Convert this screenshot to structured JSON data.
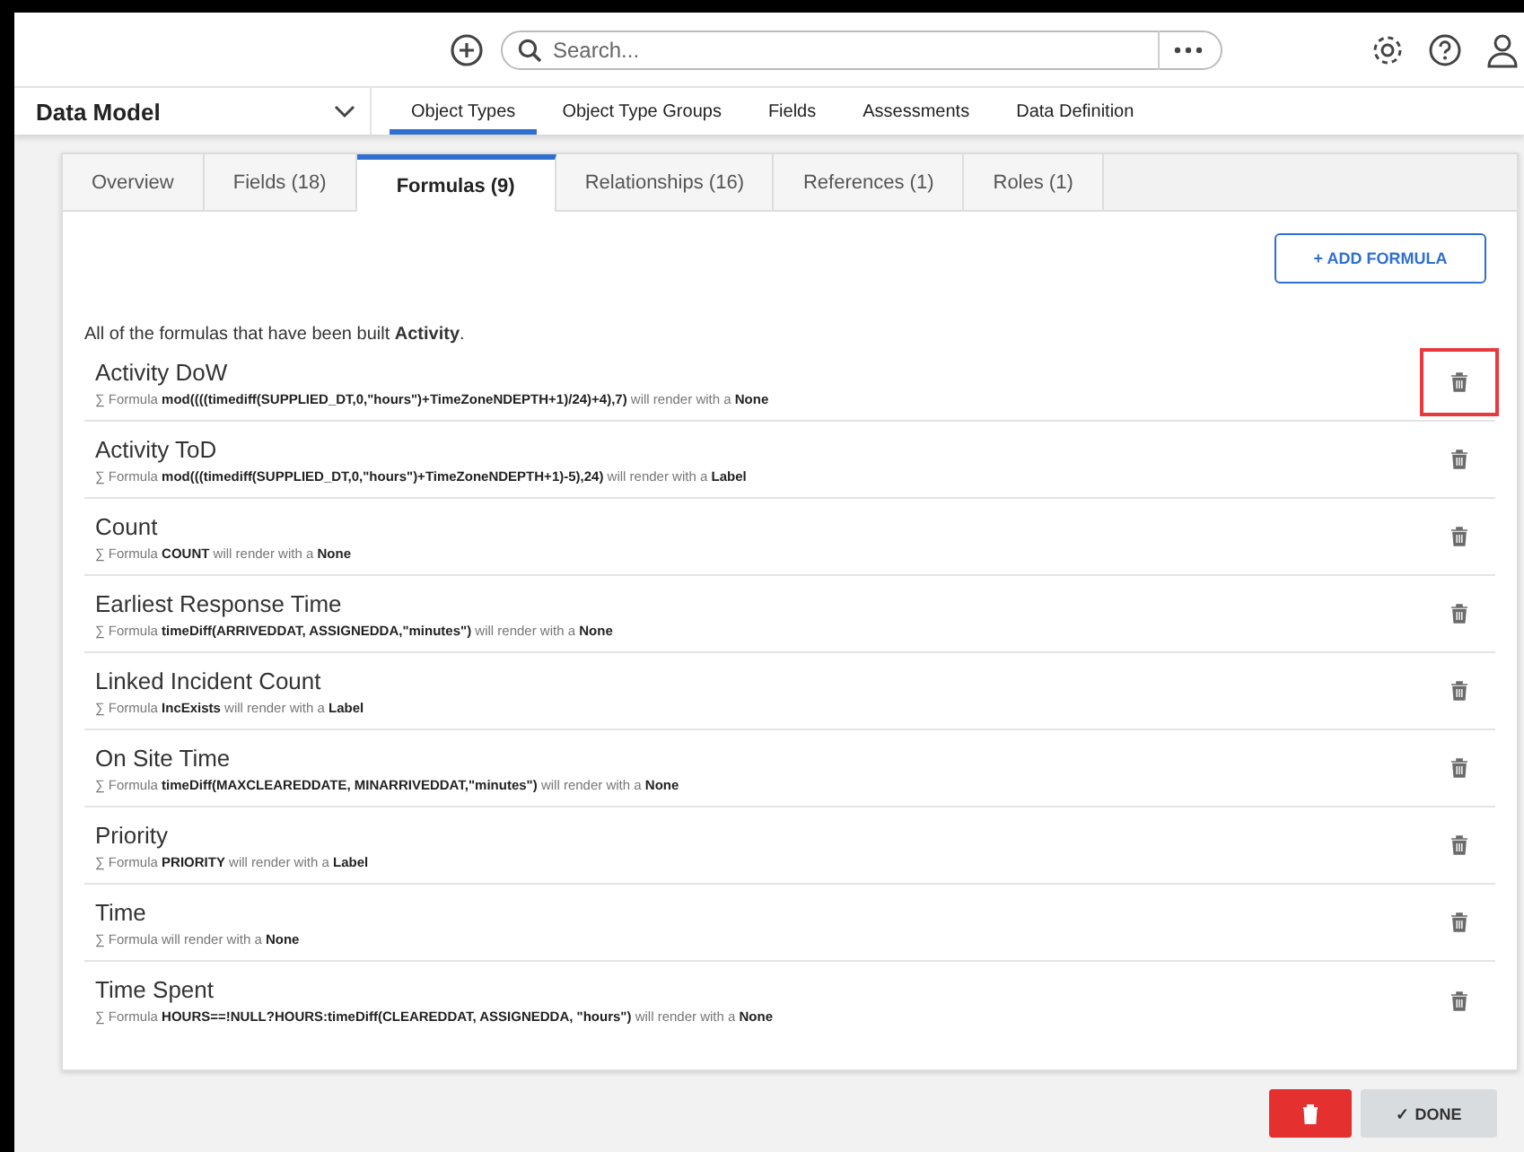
{
  "header": {
    "search": {
      "placeholder": "Search..."
    }
  },
  "nav": {
    "title": "Data Model",
    "items": [
      {
        "label": "Object Types",
        "selected": true
      },
      {
        "label": "Object Type Groups",
        "selected": false
      },
      {
        "label": "Fields",
        "selected": false
      },
      {
        "label": "Assessments",
        "selected": false
      },
      {
        "label": "Data Definition",
        "selected": false
      }
    ]
  },
  "tabs": [
    {
      "label": "Overview",
      "selected": false
    },
    {
      "label": "Fields (18)",
      "selected": false
    },
    {
      "label": "Formulas (9)",
      "selected": true
    },
    {
      "label": "Relationships (16)",
      "selected": false
    },
    {
      "label": "References (1)",
      "selected": false
    },
    {
      "label": "Roles (1)",
      "selected": false
    }
  ],
  "add_button": "+ ADD FORMULA",
  "intro": "All of the formulas that have been built **Activity**.",
  "formulas": [
    {
      "name": "Activity DoW",
      "description": "∑ Formula **mod((((timediff(SUPPLIED_DT,0,\"hours\")+TimeZoneNDEPTH+1)/24)+4),7)** will render with a **None**",
      "highlighted": true
    },
    {
      "name": "Activity ToD",
      "description": "∑ Formula **mod(((timediff(SUPPLIED_DT,0,\"hours\")+TimeZoneNDEPTH+1)-5),24)** will render with a **Label**",
      "highlighted": false
    },
    {
      "name": "Count",
      "description": "∑ Formula **COUNT** will render with a **None**",
      "highlighted": false
    },
    {
      "name": "Earliest Response Time",
      "description": "∑ Formula **timeDiff(ARRIVEDDAT, ASSIGNEDDA,\"minutes\")** will render with a **None**",
      "highlighted": false
    },
    {
      "name": "Linked Incident Count",
      "description": "∑ Formula **IncExists** will render with a **Label**",
      "highlighted": false
    },
    {
      "name": "On Site Time",
      "description": "∑ Formula **timeDiff(MAXCLEAREDDATE, MINARRIVEDDAT,\"minutes\")** will render with a **None**",
      "highlighted": false
    },
    {
      "name": "Priority",
      "description": "∑ Formula **PRIORITY** will render with a **Label**",
      "highlighted": false
    },
    {
      "name": "Time",
      "description": "∑ Formula will render with a **None**",
      "highlighted": false
    },
    {
      "name": "Time Spent",
      "description": "∑ Formula **HOURS==!NULL?HOURS:timeDiff(CLEAREDDAT, ASSIGNEDDA, \"hours\")** will render with a **None**",
      "highlighted": false
    }
  ],
  "done_button": "✓ DONE"
}
